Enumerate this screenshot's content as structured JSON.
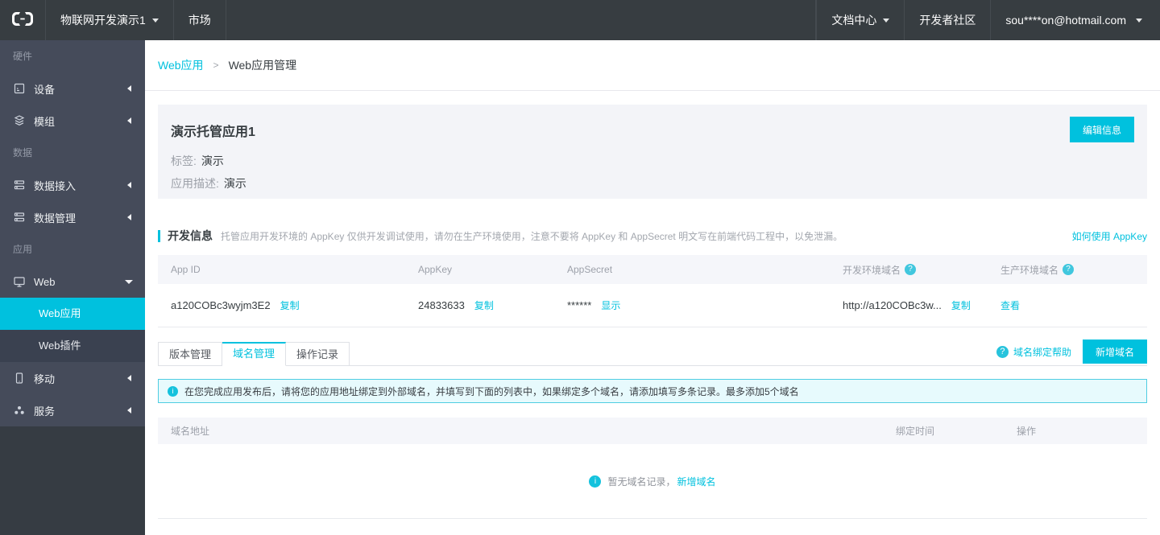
{
  "colors": {
    "accent": "#00c1de",
    "topnav_bg": "#373d41",
    "sidebar_bg": "#454b5a"
  },
  "icons": {
    "question_glyph": "?",
    "info_glyph": "i"
  },
  "topnav": {
    "product_label": "物联网开发演示1",
    "market_label": "市场",
    "doc_center_label": "文档中心",
    "community_label": "开发者社区",
    "account_label": "sou****on@hotmail.com"
  },
  "sidebar": {
    "sections": {
      "hardware": "硬件",
      "data": "数据",
      "app": "应用"
    },
    "items": {
      "device": "设备",
      "module": "模组",
      "data_access": "数据接入",
      "data_mgmt": "数据管理",
      "web": "Web",
      "web_app": "Web应用",
      "web_plugin": "Web插件",
      "mobile": "移动",
      "service": "服务"
    }
  },
  "breadcrumb": {
    "parent": "Web应用",
    "separator": ">",
    "current": "Web应用管理"
  },
  "app_card": {
    "title": "演示托管应用1",
    "tag_label": "标签:",
    "tag_value": "演示",
    "desc_label": "应用描述:",
    "desc_value": "演示",
    "edit_button": "编辑信息"
  },
  "dev_info": {
    "title": "开发信息",
    "subtitle": "托管应用开发环境的 AppKey 仅供开发调试使用，请勿在生产环境使用，注意不要将 AppKey 和 AppSecret 明文写在前端代码工程中，以免泄漏。",
    "help_link": "如何使用 AppKey",
    "headers": {
      "app_id": "App ID",
      "app_key": "AppKey",
      "app_secret": "AppSecret",
      "dev_domain": "开发环境域名",
      "prod_domain": "生产环境域名"
    },
    "row": {
      "app_id": "a120COBc3wyjm3E2",
      "copy_label": "复制",
      "app_key": "24833633",
      "app_secret_masked": "******",
      "show_label": "显示",
      "dev_domain": "http://a120COBc3w...",
      "view_label": "查看"
    }
  },
  "tabs": {
    "version": "版本管理",
    "domain": "域名管理",
    "operations": "操作记录",
    "domain_help": "域名绑定帮助",
    "add_domain_button": "新增域名"
  },
  "domain_section": {
    "notice": "在您完成应用发布后，请将您的应用地址绑定到外部域名，并填写到下面的列表中，如果绑定多个域名，请添加填写多条记录。最多添加5个域名",
    "headers": {
      "address": "域名地址",
      "bind_time": "绑定时间",
      "action": "操作"
    },
    "empty_text": "暂无域名记录，",
    "empty_link": "新增域名"
  }
}
